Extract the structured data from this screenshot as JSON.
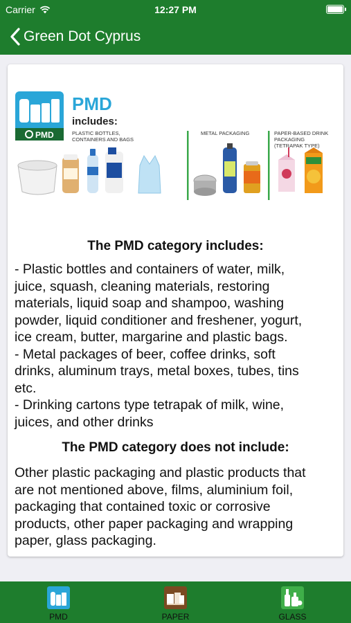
{
  "status_bar": {
    "carrier": "Carrier",
    "time": "12:27 PM"
  },
  "nav": {
    "back_title": "Green Dot Cyprus"
  },
  "infographic": {
    "badge_label": "PMD",
    "title": "PMD",
    "subtitle": "includes:",
    "groups": [
      {
        "label_lines": [
          "PLASTIC BOTTLES,",
          "CONTAINERS AND BAGS"
        ]
      },
      {
        "label_lines": [
          "METAL PACKAGING"
        ]
      },
      {
        "label_lines": [
          "PAPER-BASED DRINK",
          "PACKAGING",
          "(TETRAPAK TYPE)"
        ]
      }
    ]
  },
  "content": {
    "includes_heading": "The PMD category includes:",
    "includes_lines": [
      "- Plastic bottles and containers of water, milk,",
      "juice, squash, cleaning materials, restoring",
      "materials, liquid soap and shampoo, washing",
      "powder, liquid conditioner and freshener, yogurt,",
      "ice cream, butter, margarine and plastic bags.",
      "- Metal packages of beer, coffee drinks, soft",
      "drinks, aluminum trays, metal boxes, tubes, tins",
      "etc.",
      "- Drinking cartons type tetrapak of milk, wine,",
      "juices, and other drinks"
    ],
    "excludes_heading": "The PMD category does not include:",
    "excludes_lines": [
      "Other plastic packaging and plastic products that",
      "are not mentioned above, films, aluminium foil,",
      "packaging that contained toxic or corrosive",
      "products, other paper packaging and wrapping",
      "paper, glass packaging."
    ]
  },
  "tabs": [
    {
      "label": "PMD",
      "icon": "pmd-bottles-icon",
      "color": "#2aa6d8"
    },
    {
      "label": "PAPER",
      "icon": "paper-icon",
      "color": "#7a4a22"
    },
    {
      "label": "GLASS",
      "icon": "glass-bottles-icon",
      "color": "#3fae49"
    }
  ],
  "colors": {
    "brand_green": "#1e7d2d",
    "pmd_blue": "#2aa6d8",
    "divider_green": "#3aa84a"
  }
}
